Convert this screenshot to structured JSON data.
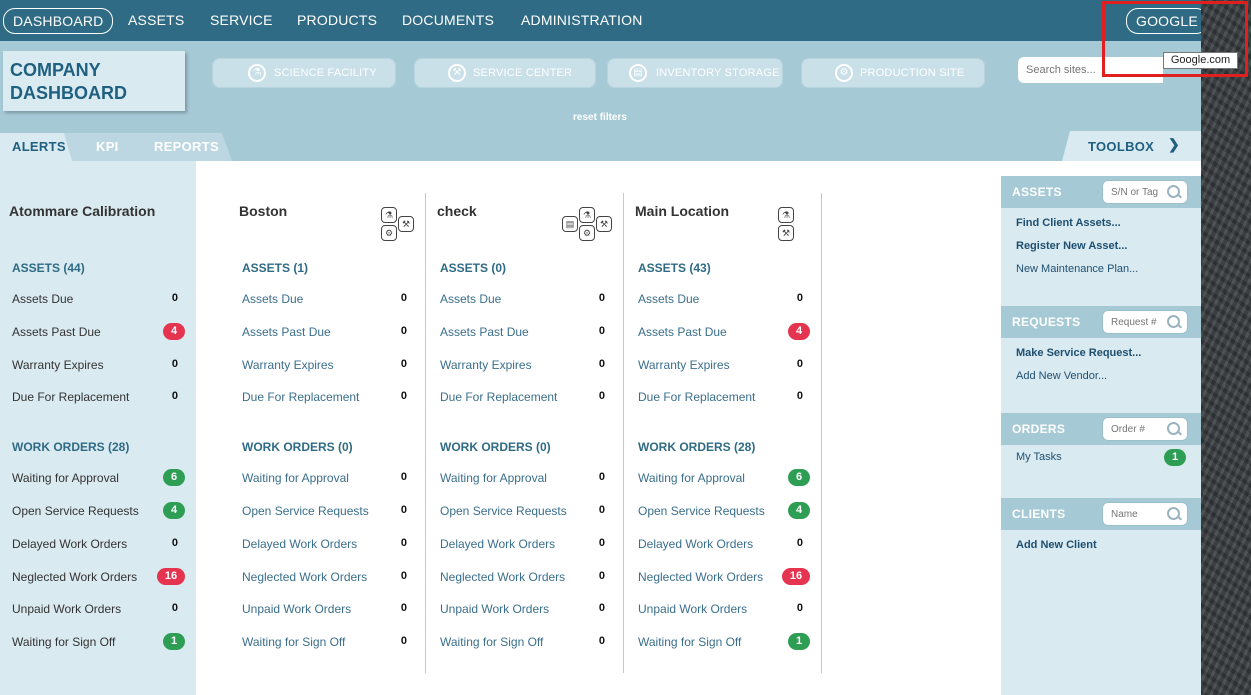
{
  "nav": {
    "items": [
      "DASHBOARD",
      "ASSETS",
      "SERVICE",
      "PRODUCTS",
      "DOCUMENTS",
      "ADMINISTRATION"
    ],
    "google_label": "GOOGLE"
  },
  "tooltip": "Google.com",
  "header": {
    "logo": "COMPANY\nDASHBOARD",
    "sites": [
      "SCIENCE FACILITY",
      "SERVICE CENTER",
      "INVENTORY STORAGE",
      "PRODUCTION SITE"
    ],
    "search_placeholder": "Search sites..."
  },
  "tabs": [
    "ALERTS",
    "KPI",
    "REPORTS"
  ],
  "reset_filters": "reset filters",
  "toolbox_label": "TOOLBOX",
  "columns": [
    {
      "title": "Atommare Calibration",
      "assets_title": "ASSETS (44)",
      "assets": [
        {
          "label": "Assets Due",
          "value": "0",
          "badge": ""
        },
        {
          "label": "Assets Past Due",
          "value": "4",
          "badge": "red"
        },
        {
          "label": "Warranty Expires",
          "value": "0",
          "badge": ""
        },
        {
          "label": "Due For Replacement",
          "value": "0",
          "badge": ""
        }
      ],
      "wo_title": "WORK ORDERS (28)",
      "work_orders": [
        {
          "label": "Waiting for Approval",
          "value": "6",
          "badge": "green"
        },
        {
          "label": "Open Service Requests",
          "value": "4",
          "badge": "green"
        },
        {
          "label": "Delayed Work Orders",
          "value": "0",
          "badge": ""
        },
        {
          "label": "Neglected Work Orders",
          "value": "16",
          "badge": "red"
        },
        {
          "label": "Unpaid Work Orders",
          "value": "0",
          "badge": ""
        },
        {
          "label": "Waiting for Sign Off",
          "value": "1",
          "badge": "green"
        }
      ]
    },
    {
      "title": "Boston",
      "assets_title": "ASSETS (1)",
      "assets": [
        {
          "label": "Assets Due",
          "value": "0",
          "badge": ""
        },
        {
          "label": "Assets Past Due",
          "value": "0",
          "badge": ""
        },
        {
          "label": "Warranty Expires",
          "value": "0",
          "badge": ""
        },
        {
          "label": "Due For Replacement",
          "value": "0",
          "badge": ""
        }
      ],
      "wo_title": "WORK ORDERS (0)",
      "work_orders": [
        {
          "label": "Waiting for Approval",
          "value": "0",
          "badge": ""
        },
        {
          "label": "Open Service Requests",
          "value": "0",
          "badge": ""
        },
        {
          "label": "Delayed Work Orders",
          "value": "0",
          "badge": ""
        },
        {
          "label": "Neglected Work Orders",
          "value": "0",
          "badge": ""
        },
        {
          "label": "Unpaid Work Orders",
          "value": "0",
          "badge": ""
        },
        {
          "label": "Waiting for Sign Off",
          "value": "0",
          "badge": ""
        }
      ]
    },
    {
      "title": "check",
      "assets_title": "ASSETS (0)",
      "assets": [
        {
          "label": "Assets Due",
          "value": "0",
          "badge": ""
        },
        {
          "label": "Assets Past Due",
          "value": "0",
          "badge": ""
        },
        {
          "label": "Warranty Expires",
          "value": "0",
          "badge": ""
        },
        {
          "label": "Due For Replacement",
          "value": "0",
          "badge": ""
        }
      ],
      "wo_title": "WORK ORDERS (0)",
      "work_orders": [
        {
          "label": "Waiting for Approval",
          "value": "0",
          "badge": ""
        },
        {
          "label": "Open Service Requests",
          "value": "0",
          "badge": ""
        },
        {
          "label": "Delayed Work Orders",
          "value": "0",
          "badge": ""
        },
        {
          "label": "Neglected Work Orders",
          "value": "0",
          "badge": ""
        },
        {
          "label": "Unpaid Work Orders",
          "value": "0",
          "badge": ""
        },
        {
          "label": "Waiting for Sign Off",
          "value": "0",
          "badge": ""
        }
      ]
    },
    {
      "title": "Main Location",
      "assets_title": "ASSETS (43)",
      "assets": [
        {
          "label": "Assets Due",
          "value": "0",
          "badge": ""
        },
        {
          "label": "Assets Past Due",
          "value": "4",
          "badge": "red"
        },
        {
          "label": "Warranty Expires",
          "value": "0",
          "badge": ""
        },
        {
          "label": "Due For Replacement",
          "value": "0",
          "badge": ""
        }
      ],
      "wo_title": "WORK ORDERS (28)",
      "work_orders": [
        {
          "label": "Waiting for Approval",
          "value": "6",
          "badge": "green"
        },
        {
          "label": "Open Service Requests",
          "value": "4",
          "badge": "green"
        },
        {
          "label": "Delayed Work Orders",
          "value": "0",
          "badge": ""
        },
        {
          "label": "Neglected Work Orders",
          "value": "16",
          "badge": "red"
        },
        {
          "label": "Unpaid Work Orders",
          "value": "0",
          "badge": ""
        },
        {
          "label": "Waiting for Sign Off",
          "value": "1",
          "badge": "green"
        }
      ]
    }
  ],
  "toolbox": {
    "sections": [
      {
        "title": "ASSETS",
        "placeholder": "S/N or Tag",
        "links": [
          {
            "label": "Find Client Assets...",
            "bold": true
          },
          {
            "label": "Register New Asset...",
            "bold": true
          },
          {
            "label": "New Maintenance Plan...",
            "bold": false
          }
        ]
      },
      {
        "title": "REQUESTS",
        "placeholder": "Request #",
        "links": [
          {
            "label": "Make Service Request...",
            "bold": true
          },
          {
            "label": "Add New Vendor...",
            "bold": false
          }
        ]
      },
      {
        "title": "ORDERS",
        "placeholder": "Order #",
        "links": [
          {
            "label": "My Tasks",
            "bold": false,
            "badge": "1"
          }
        ]
      },
      {
        "title": "CLIENTS",
        "placeholder": "Name",
        "links": [
          {
            "label": "Add New Client",
            "bold": true
          }
        ]
      }
    ]
  },
  "colors": {
    "nav_bg": "#2f6b85",
    "header_bg": "#a6c9d6",
    "panel_bg": "#d9eaf0",
    "badge_red": "#e5344f",
    "badge_green": "#2f9e55",
    "highlight": "#e01f1f"
  }
}
